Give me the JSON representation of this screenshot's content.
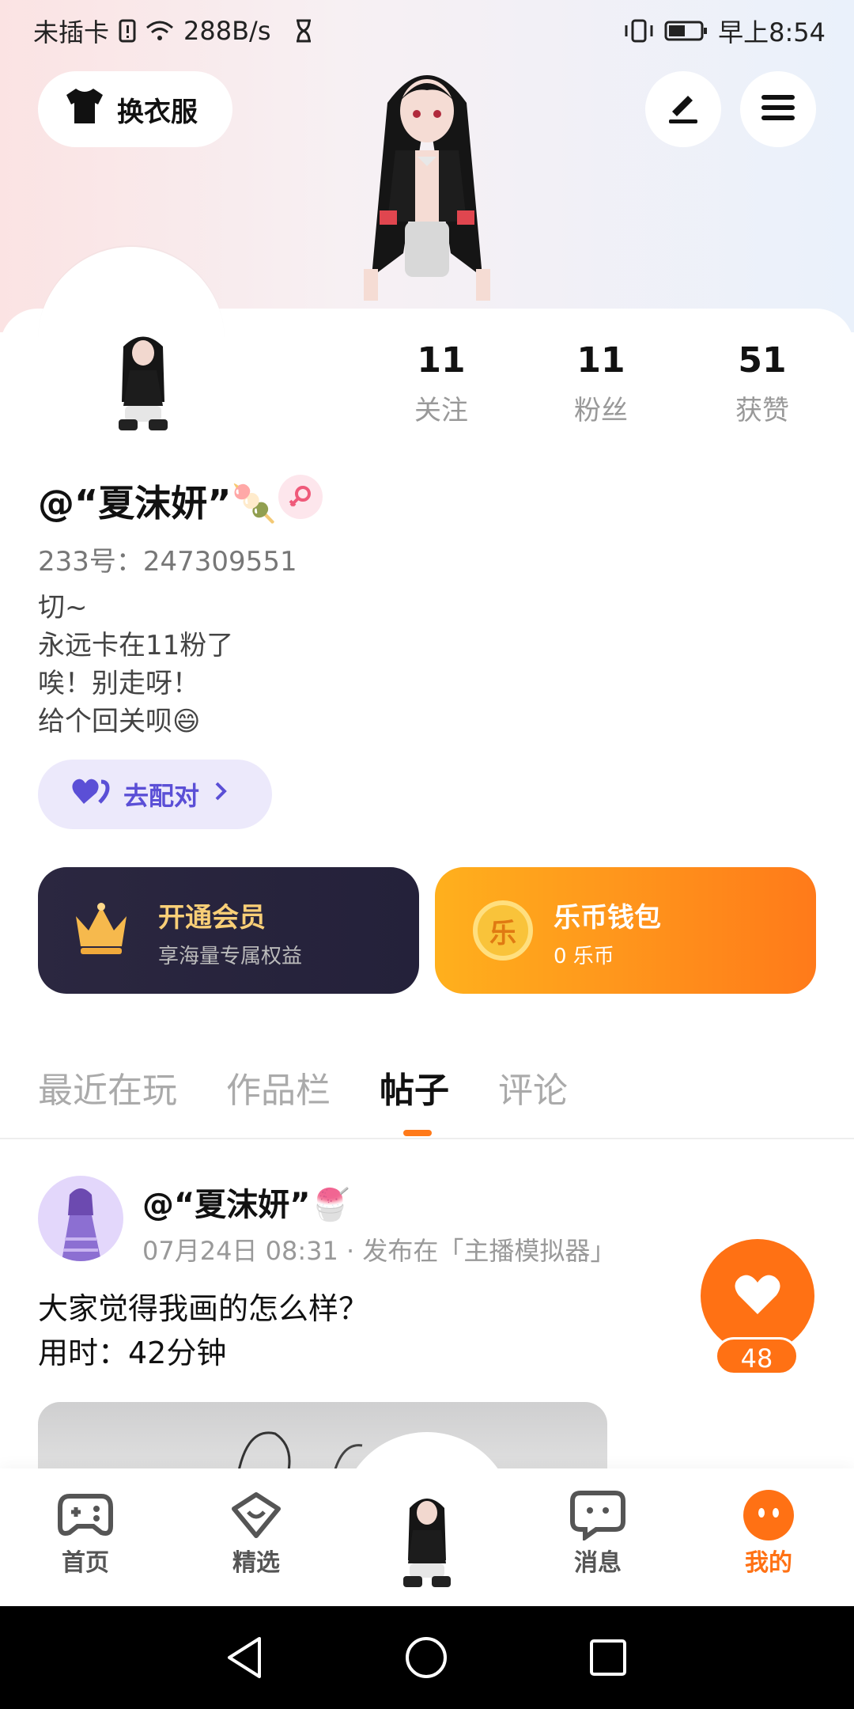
{
  "status_bar": {
    "carrier": "未插卡",
    "speed": "288B/s",
    "time": "早上8:54"
  },
  "header": {
    "dress_button": "换衣服"
  },
  "stats": [
    {
      "value": "11",
      "label": "关注"
    },
    {
      "value": "11",
      "label": "粉丝"
    },
    {
      "value": "51",
      "label": "获赞"
    }
  ],
  "profile": {
    "name": "@“夏沫妍”🍡",
    "uid": "233号：247309551",
    "bio": [
      "切~",
      "永远卡在11粉了",
      "唉！别走呀！",
      "给个回关呗😄"
    ],
    "match_button": "去配对"
  },
  "cards": {
    "vip": {
      "title": "开通会员",
      "subtitle": "享海量专属权益"
    },
    "wallet": {
      "title": "乐币钱包",
      "subtitle": "0 乐币",
      "coin_char": "乐"
    }
  },
  "tabs": [
    "最近在玩",
    "作品栏",
    "帖子",
    "评论"
  ],
  "active_tab": "帖子",
  "post": {
    "author": "@“夏沫妍”🍧",
    "meta": "07月24日 08:31 · 发布在「主播模拟器」",
    "text": [
      "大家觉得我画的怎么样？",
      "用时：42分钟"
    ],
    "likes": "48"
  },
  "bottom_nav": [
    {
      "label": "首页",
      "icon": "gamepad-icon"
    },
    {
      "label": "精选",
      "icon": "heart-chat-icon"
    },
    {
      "label": "消息",
      "icon": "message-icon"
    },
    {
      "label": "我的",
      "icon": "face-icon"
    }
  ],
  "colors": {
    "accent": "#ff7114",
    "match_purple": "#5b4fd6",
    "vip_gold": "#f9cf77"
  }
}
